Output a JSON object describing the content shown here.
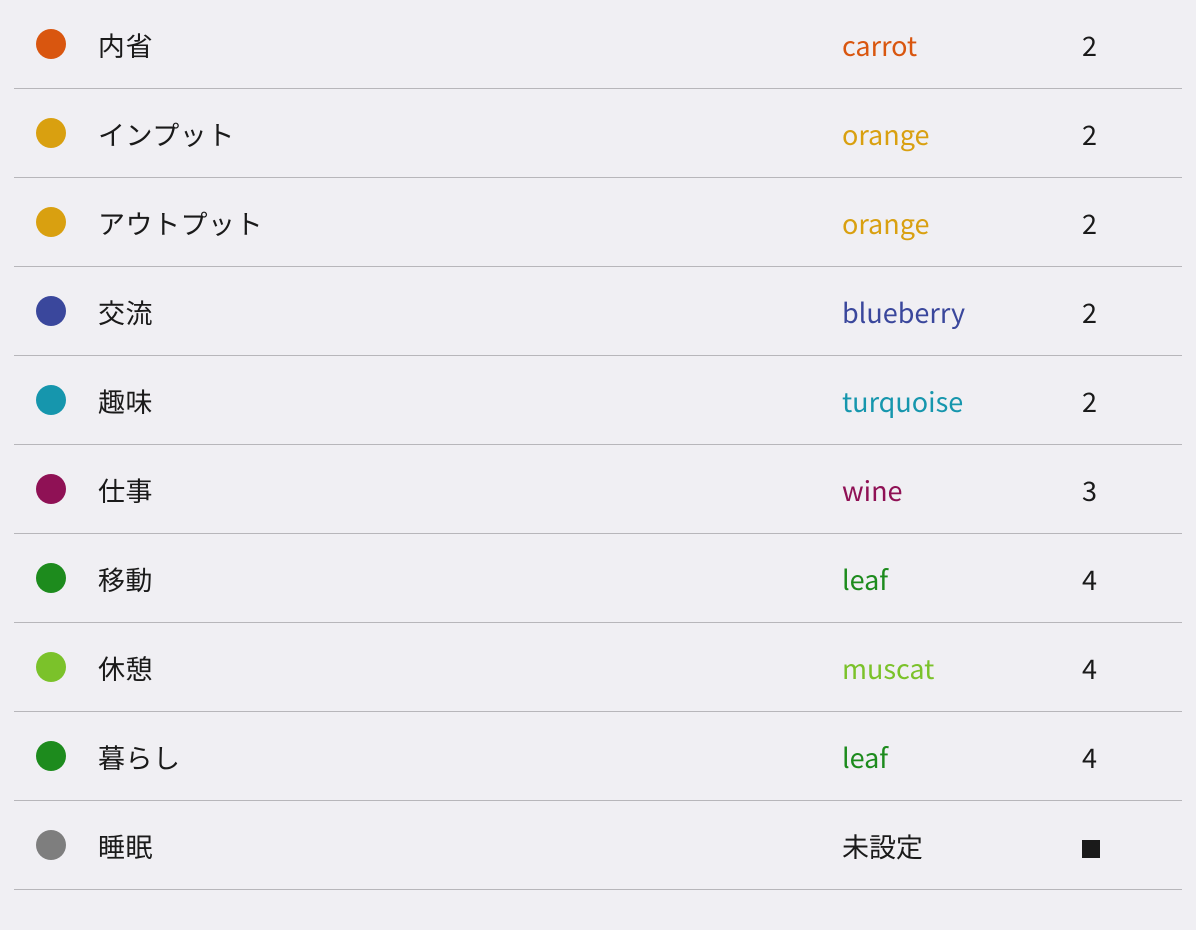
{
  "colors": {
    "carrot": "#d9560f",
    "orange": "#d9a010",
    "blueberry": "#3a479c",
    "turquoise": "#1696ad",
    "wine": "#8f1155",
    "leaf": "#1d8b1d",
    "muscat": "#7bc22a",
    "unset": "#7e7e7e"
  },
  "labelColors": {
    "carrot": "#d9560f",
    "orange": "#d9a010",
    "blueberry": "#3a479c",
    "turquoise": "#1696ad",
    "wine": "#8f1155",
    "leaf": "#1d8b1d",
    "muscat": "#7bc22a",
    "unset": "#1a1a1a"
  },
  "unsetLabel": "未設定",
  "rows": [
    {
      "name": "内省",
      "colorKey": "carrot",
      "colorLabel": "carrot",
      "value": "2"
    },
    {
      "name": "インプット",
      "colorKey": "orange",
      "colorLabel": "orange",
      "value": "2"
    },
    {
      "name": "アウトプット",
      "colorKey": "orange",
      "colorLabel": "orange",
      "value": "2"
    },
    {
      "name": "交流",
      "colorKey": "blueberry",
      "colorLabel": "blueberry",
      "value": "2"
    },
    {
      "name": "趣味",
      "colorKey": "turquoise",
      "colorLabel": "turquoise",
      "value": "2"
    },
    {
      "name": "仕事",
      "colorKey": "wine",
      "colorLabel": "wine",
      "value": "3"
    },
    {
      "name": "移動",
      "colorKey": "leaf",
      "colorLabel": "leaf",
      "value": "4"
    },
    {
      "name": "休憩",
      "colorKey": "muscat",
      "colorLabel": "muscat",
      "value": "4"
    },
    {
      "name": "暮らし",
      "colorKey": "leaf",
      "colorLabel": "leaf",
      "value": "4"
    },
    {
      "name": "睡眠",
      "colorKey": "unset",
      "colorLabel": "未設定",
      "value": "■"
    }
  ]
}
